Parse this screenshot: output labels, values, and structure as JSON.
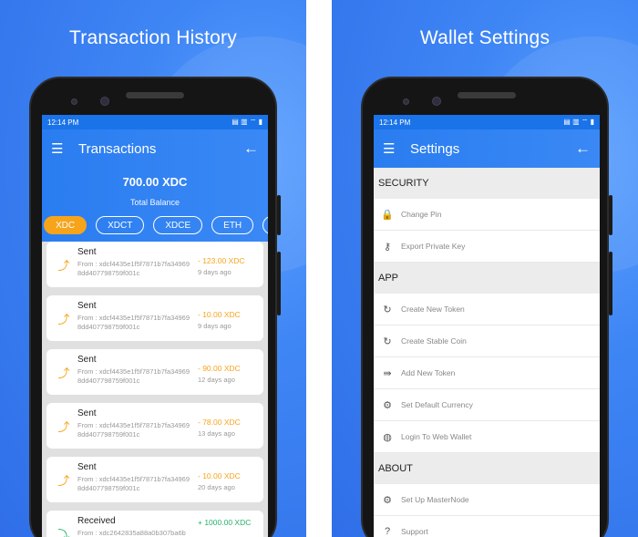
{
  "left": {
    "headline": "Transaction History",
    "status": {
      "time": "12:14 PM",
      "icons": "▤ ▥ ⌔ ▮"
    },
    "appbar": {
      "title": "Transactions"
    },
    "balance": {
      "amount": "700.00 XDC",
      "label": "Total Balance"
    },
    "tokens": [
      "XDC",
      "XDCT",
      "XDCE",
      "ETH",
      ""
    ],
    "transactions": [
      {
        "type": "Sent",
        "from": "From : xdcf4435e1f5f7871b7fa349698dd407798759f001c",
        "value": "- 123.00 XDC",
        "ago": "9 days ago"
      },
      {
        "type": "Sent",
        "from": "From : xdcf4435e1f5f7871b7fa349698dd407798759f001c",
        "value": "- 10.00 XDC",
        "ago": "9 days ago"
      },
      {
        "type": "Sent",
        "from": "From : xdcf4435e1f5f7871b7fa349698dd407798759f001c",
        "value": "- 90.00 XDC",
        "ago": "12 days ago"
      },
      {
        "type": "Sent",
        "from": "From : xdcf4435e1f5f7871b7fa349698dd407798759f001c",
        "value": "- 78.00 XDC",
        "ago": "13 days ago"
      },
      {
        "type": "Sent",
        "from": "From : xdcf4435e1f5f7871b7fa349698dd407798759f001c",
        "value": "- 10.00 XDC",
        "ago": "20 days ago"
      },
      {
        "type": "Received",
        "from": "From : xdc2642835a88a0b307ba6b",
        "value": "+ 1000.00 XDC",
        "ago": ""
      }
    ]
  },
  "right": {
    "headline": "Wallet Settings",
    "status": {
      "time": "12:14 PM",
      "icons": "▤ ▥ ⌔ ▮"
    },
    "appbar": {
      "title": "Settings"
    },
    "sections": [
      {
        "title": "SECURITY",
        "items": [
          {
            "label": "Change Pin",
            "icon": "lock-icon",
            "glyph": "🔒"
          },
          {
            "label": "Export Private Key",
            "icon": "key-icon",
            "glyph": "⚷"
          }
        ]
      },
      {
        "title": "APP",
        "items": [
          {
            "label": "Create New Token",
            "icon": "create-token-icon",
            "glyph": "↻"
          },
          {
            "label": "Create Stable Coin",
            "icon": "create-coin-icon",
            "glyph": "↻"
          },
          {
            "label": "Add New Token",
            "icon": "add-token-icon",
            "glyph": "⇛"
          },
          {
            "label": "Set Default Currency",
            "icon": "currency-icon",
            "glyph": "⚙"
          },
          {
            "label": "Login To Web Wallet",
            "icon": "globe-icon",
            "glyph": "◍"
          }
        ]
      },
      {
        "title": "ABOUT",
        "items": [
          {
            "label": "Set Up MasterNode",
            "icon": "masternode-icon",
            "glyph": "⚙"
          },
          {
            "label": "Support",
            "icon": "help-icon",
            "glyph": "?"
          }
        ]
      }
    ]
  },
  "colors": {
    "accent": "#f7a41b",
    "brand": "#2a7df0",
    "received": "#25b06a"
  }
}
